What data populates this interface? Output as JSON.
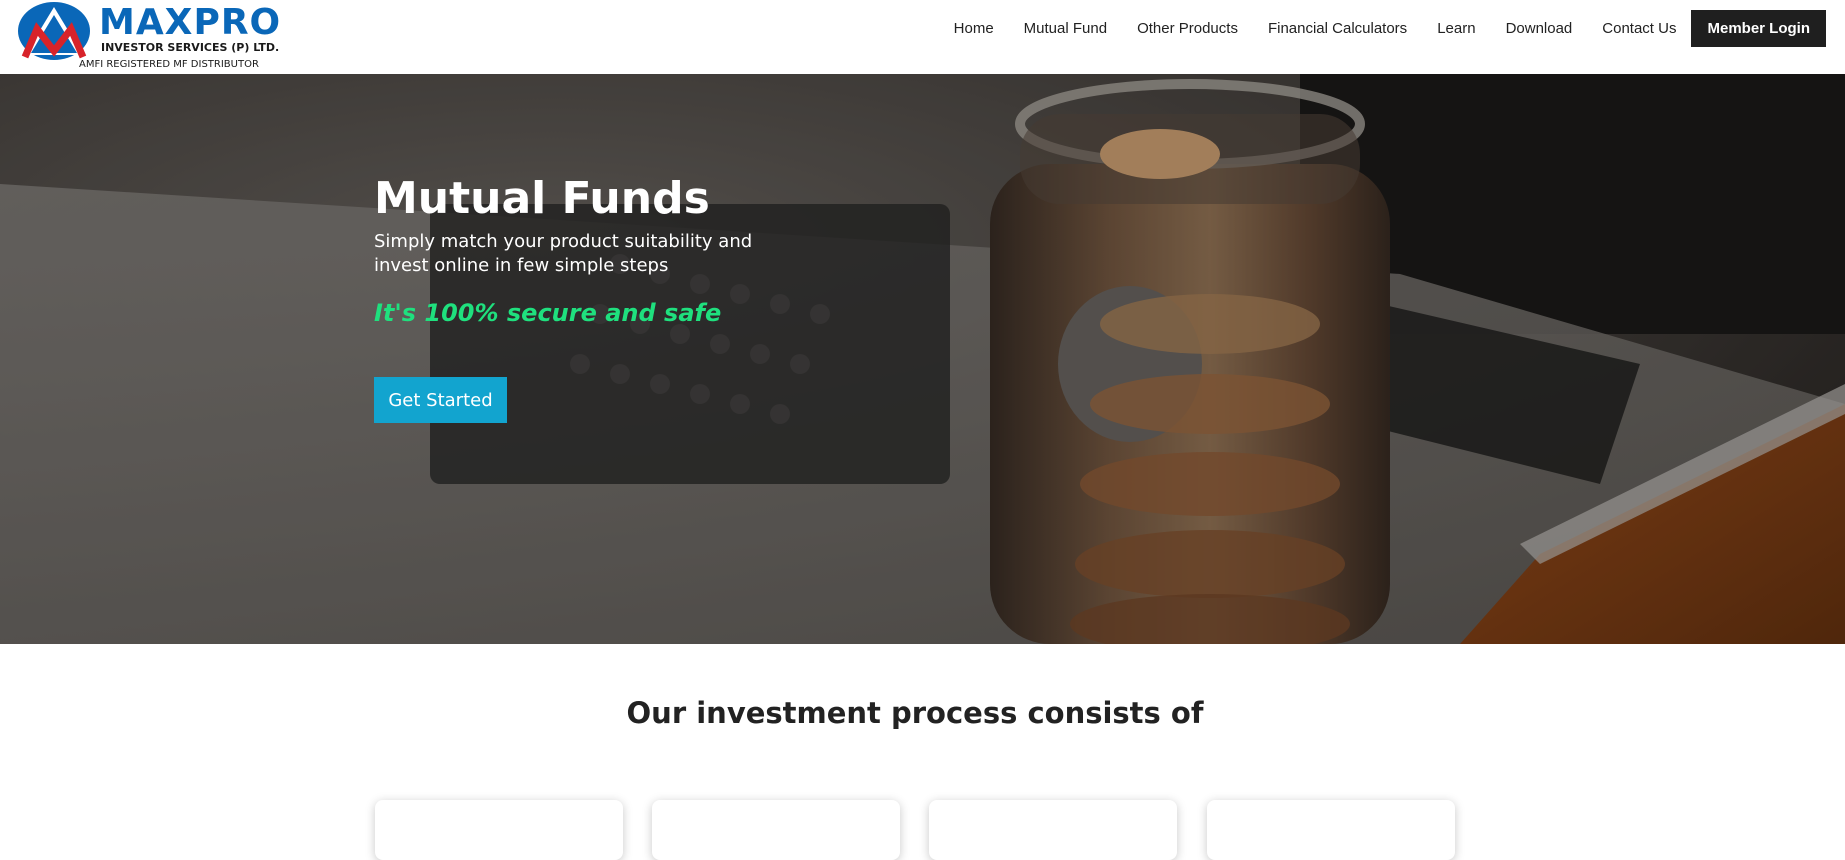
{
  "brand": {
    "name": "MAXPRO",
    "subtitle": "INVESTOR SERVICES (P) LTD.",
    "tagline": "AMFI REGISTERED MF DISTRIBUTOR",
    "primary_color": "#0a67b8",
    "accent_color": "#d8232a"
  },
  "nav": {
    "items": [
      "Home",
      "Mutual Fund",
      "Other Products",
      "Financial Calculators",
      "Learn",
      "Download",
      "Contact Us"
    ],
    "login_label": "Member Login"
  },
  "hero": {
    "title": "Mutual Funds",
    "subtitle": "Simply match your product suitability and invest online in few simple steps",
    "secure_text": "It's 100% secure and safe",
    "cta_label": "Get Started",
    "secure_color": "#1fe07e",
    "cta_color": "#12a4cf"
  },
  "process": {
    "title": "Our investment process consists of",
    "card_count": 4
  }
}
